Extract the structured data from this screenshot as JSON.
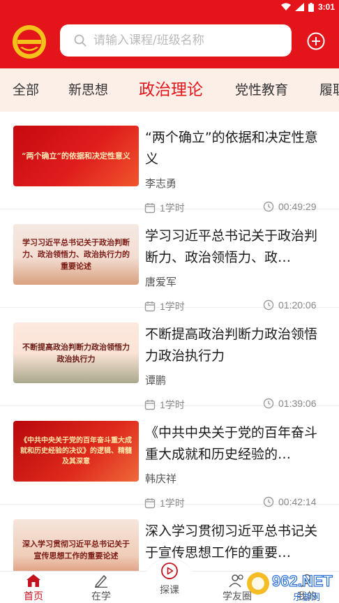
{
  "status_bar": {
    "time": "3:01"
  },
  "header": {
    "search_placeholder": "请输入课程/班级名称"
  },
  "tabs": [
    {
      "label": "全部",
      "active": false
    },
    {
      "label": "新思想",
      "active": false
    },
    {
      "label": "政治理论",
      "active": true
    },
    {
      "label": "党性教育",
      "active": false
    },
    {
      "label": "履职",
      "active": false
    }
  ],
  "courses": [
    {
      "thumb_text": "“两个确立”的依据和决定性意义",
      "title": "“两个确立”的依据和决定性意义",
      "author": "李志勇",
      "hours": "1学时",
      "duration": "00:49:29"
    },
    {
      "thumb_text": "学习习近平总书记关于政治判断力、政治领悟力、政治执行力的重要论述",
      "title": "学习习近平总书记关于政治判断力、政治领悟力、政…",
      "author": "唐爱军",
      "hours": "1学时",
      "duration": "01:20:06"
    },
    {
      "thumb_text": "不断提高政治判断力政治领悟力政治执行力",
      "title": "不断提高政治判断力政治领悟力政治执行力",
      "author": "谭鹏",
      "hours": "1学时",
      "duration": "01:39:06"
    },
    {
      "thumb_text": "《中共中央关于党的百年奋斗重大成就和历史经验的决议》的逻辑、精髓及其深意",
      "title": "《中共中央关于党的百年奋斗重大成就和历史经验的…",
      "author": "韩庆祥",
      "hours": "1学时",
      "duration": "00:42:14"
    },
    {
      "thumb_text": "深入学习贯彻习近平总书记关于宣传思想工作的重要论述",
      "title": "深入学习贯彻习近平总书记关于宣传思想工作的重要…",
      "author": "",
      "hours": "",
      "duration": ""
    }
  ],
  "bottom_nav": {
    "home": "首页",
    "studying": "在学",
    "explore": "探课",
    "circle": "学友圈",
    "mine": "我的"
  },
  "watermark": {
    "brand": "962.NET",
    "sub": "乐游网"
  },
  "colors": {
    "brand_red": "#e4141b",
    "tab_bg": "#fcefe7",
    "active_nav": "#c3121c"
  }
}
